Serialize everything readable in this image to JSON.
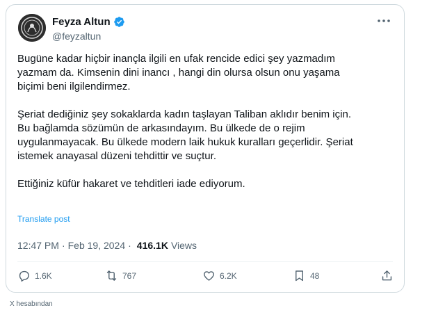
{
  "author": {
    "display_name": "Feyza Altun",
    "handle": "@feyzaltun",
    "verified": true,
    "badge_color": "#1d9bf0"
  },
  "tweet": {
    "paragraphs": [
      "Bugüne kadar hiçbir inançla ilgili en ufak rencide edici şey yazmadım\nyazmam da. Kimsenin dini inancı , hangi din olursa olsun onu yaşama\nbiçimi beni ilgilendirmez.",
      "Şeriat dediğiniz şey sokaklarda kadın taşlayan Taliban aklıdır benim için.\nBu bağlamda sözümün de arkasındayım. Bu ülkede de o rejim\nuygulanmayacak. Bu ülkede modern laik hukuk kuralları geçerlidir. Şeriat\nistemek anayasal düzeni tehdittir ve suçtur.",
      "Ettiğiniz küfür hakaret ve tehditleri iade ediyorum."
    ],
    "translate_label": "Translate post",
    "time": "12:47 PM",
    "date": "Feb 19, 2024",
    "separator": "·",
    "views_count": "416.1K",
    "views_label": "Views"
  },
  "actions": {
    "replies": "1.6K",
    "reposts": "767",
    "likes": "6.2K",
    "bookmarks": "48"
  },
  "footer": {
    "source_note": "X hesabından"
  },
  "colors": {
    "link": "#1d9bf0",
    "secondary_text": "#536471",
    "border": "#cfd9de"
  }
}
